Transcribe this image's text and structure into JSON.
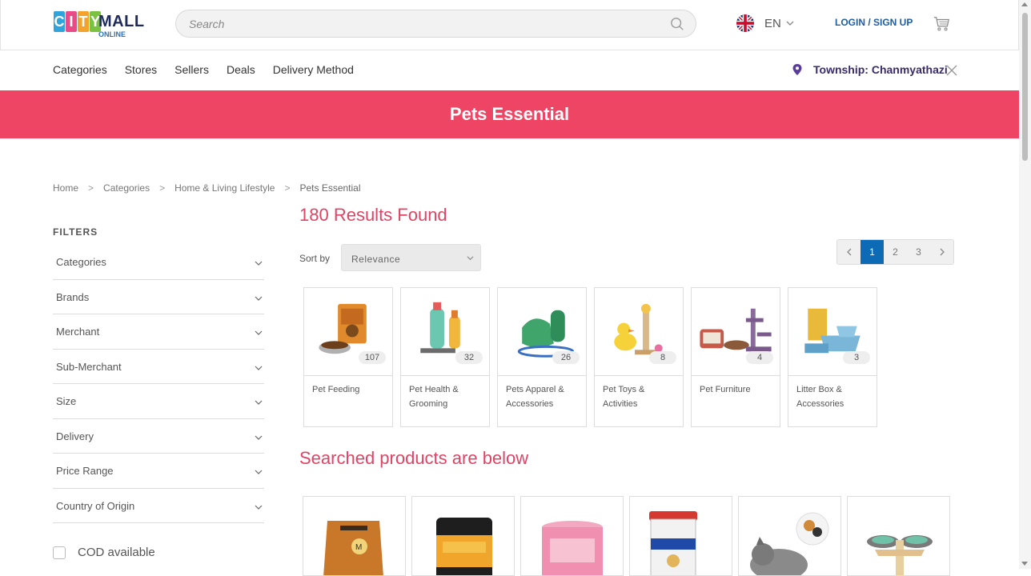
{
  "header": {
    "logo": {
      "city": "CITY",
      "mall": "MALL",
      "online": "ONLINE"
    },
    "search_placeholder": "Search",
    "language": "EN",
    "login_label": "LOGIN / SIGN UP"
  },
  "nav": {
    "items": [
      "Categories",
      "Stores",
      "Sellers",
      "Deals",
      "Delivery Method"
    ],
    "township": "Township: Chanmyathazi"
  },
  "banner": {
    "title": "Pets Essential"
  },
  "breadcrumb": [
    "Home",
    "Categories",
    "Home & Living Lifestyle",
    "Pets Essential"
  ],
  "filters": {
    "title": "FILTERS",
    "items": [
      "Categories",
      "Brands",
      "Merchant",
      "Sub-Merchant",
      "Size",
      "Delivery",
      "Price Range",
      "Country of Origin"
    ],
    "cod_label": "COD available"
  },
  "results": {
    "title": "180 Results Found",
    "sort_label": "Sort by",
    "sort_value": "Relevance",
    "pages": [
      "1",
      "2",
      "3"
    ],
    "active_page": "1"
  },
  "categories": [
    {
      "name": "Pet Feeding",
      "count": "107"
    },
    {
      "name": "Pet Health & Grooming",
      "count": "32"
    },
    {
      "name": "Pets Apparel & Accessories",
      "count": "26"
    },
    {
      "name": "Pet Toys & Activities",
      "count": "8"
    },
    {
      "name": "Pet Furniture",
      "count": "4"
    },
    {
      "name": "Litter Box & Accessories",
      "count": "3"
    }
  ],
  "searched_title": "Searched products are below",
  "colors": {
    "brand_pink": "#ef4564",
    "accent_blue": "#0d6ab5",
    "title_pink": "#e04464"
  }
}
